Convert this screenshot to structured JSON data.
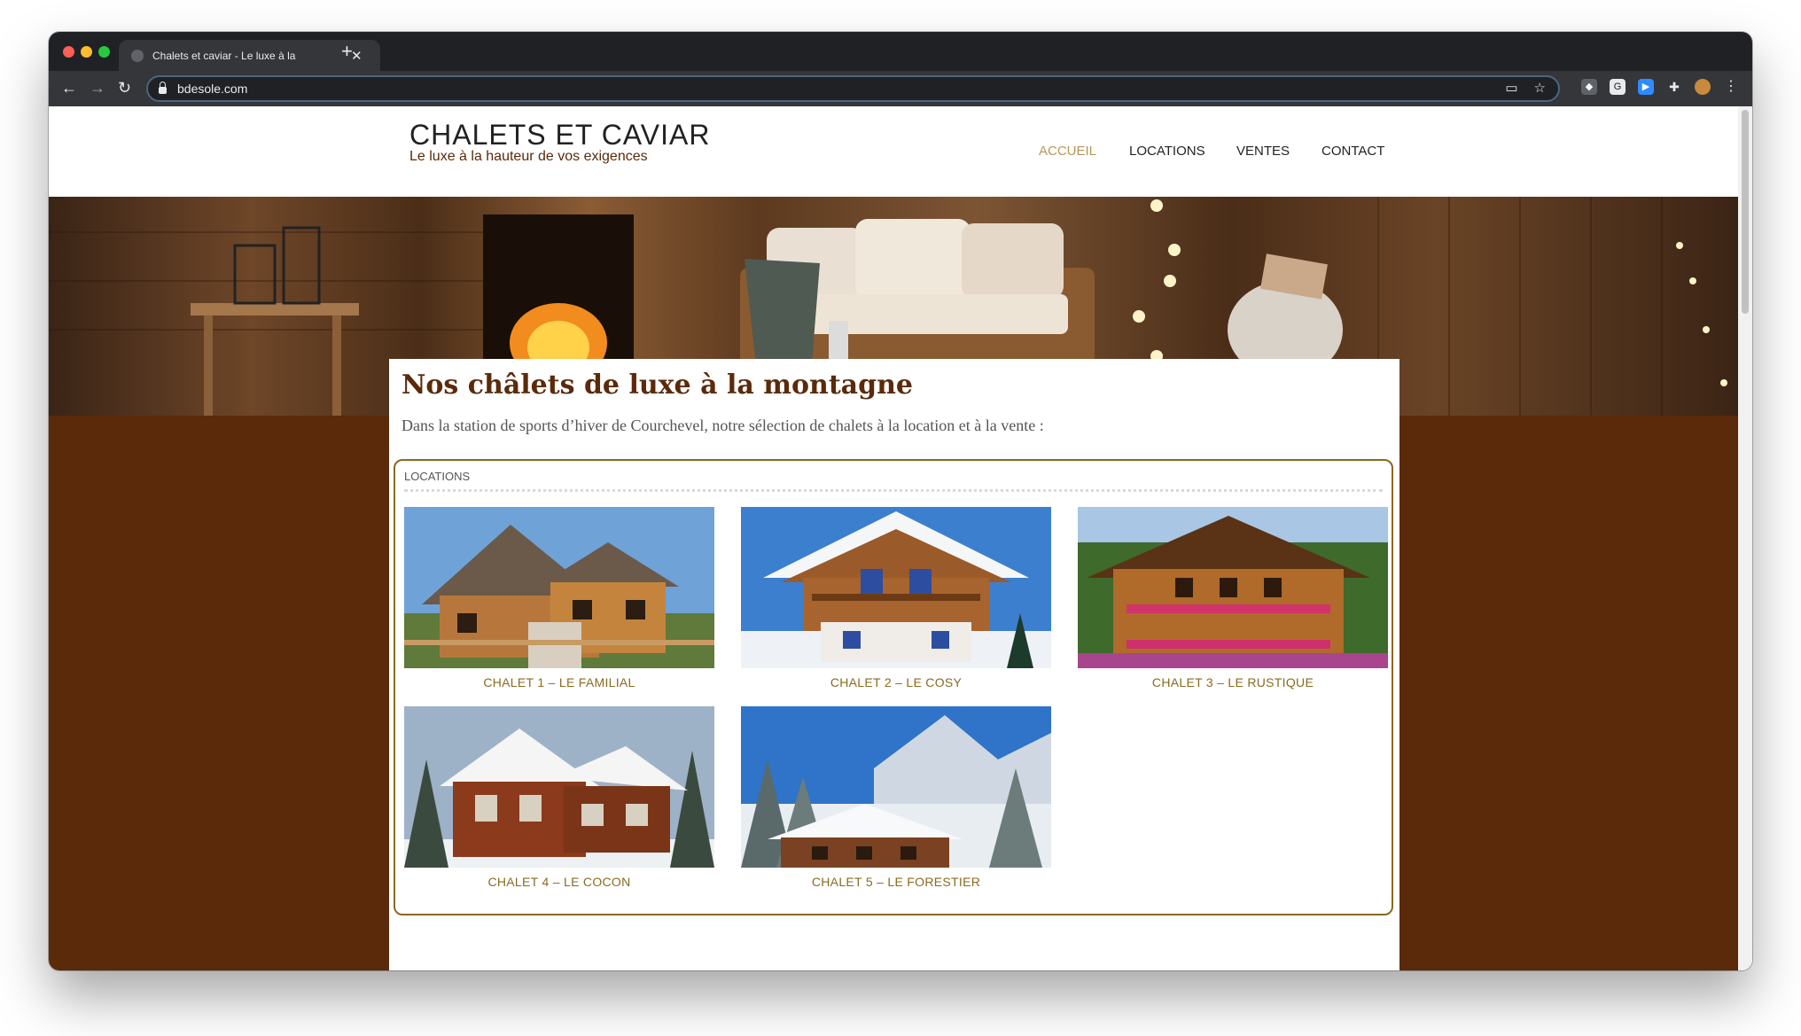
{
  "browser": {
    "tab_title": "Chalets et caviar - Le luxe à la",
    "new_tab": "+",
    "tab_close": "✕",
    "url": "bdesole.com",
    "back": "←",
    "forward": "→",
    "reload": "↻",
    "star": "☆",
    "menu": "⋮"
  },
  "site": {
    "title": "CHALETS ET CAVIAR",
    "tagline": "Le luxe à la hauteur de vos exigences",
    "nav": [
      {
        "label": "ACCUEIL",
        "active": true
      },
      {
        "label": "LOCATIONS",
        "active": false
      },
      {
        "label": "VENTES",
        "active": false
      },
      {
        "label": "CONTACT",
        "active": false
      }
    ]
  },
  "main": {
    "title": "Nos châlets de luxe à la montagne",
    "intro": "Dans la station de sports d’hiver de Courchevel, notre sélection de chalets à la location et à la vente :",
    "section_label": "LOCATIONS",
    "chalets": [
      {
        "name": "CHALET 1 – LE FAMILIAL"
      },
      {
        "name": "CHALET 2 – LE COSY"
      },
      {
        "name": "CHALET 3 – LE RUSTIQUE"
      },
      {
        "name": "CHALET 4 – LE COCON"
      },
      {
        "name": "CHALET 5 – LE FORESTIER"
      }
    ]
  },
  "colors": {
    "accent_brown": "#5a2a0a",
    "gold": "#8a6a1e",
    "nav_active": "#b8955a"
  }
}
